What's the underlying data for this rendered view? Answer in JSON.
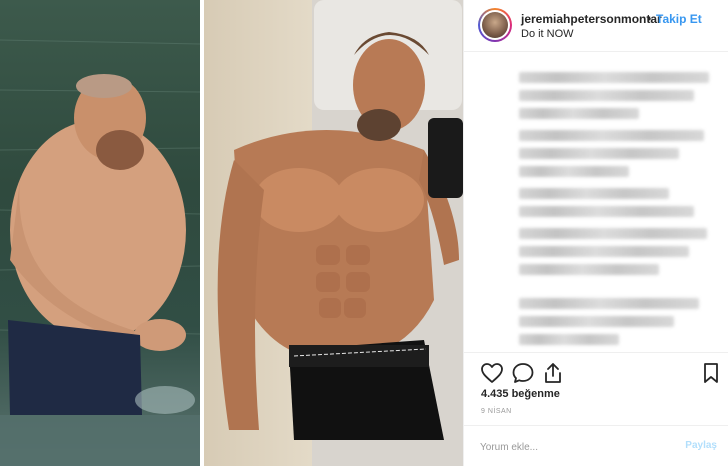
{
  "post": {
    "image": {
      "left_panel": "before-photo",
      "right_panel": "after-photo"
    }
  },
  "header": {
    "username": "jeremiahpetersonmontar",
    "dot": "•",
    "follow_label": "Takip Et",
    "subtitle": "Do it NOW"
  },
  "actions": {
    "like_icon": "heart-icon",
    "comment_icon": "comment-icon",
    "share_icon": "share-icon",
    "save_icon": "bookmark-icon"
  },
  "likes_text": "4.435 beğenme",
  "date_text": "9 NİSAN",
  "comment": {
    "placeholder": "Yorum ekle...",
    "submit_label": "Paylaş"
  },
  "colors": {
    "accent": "#3897f0",
    "muted": "#999999",
    "border": "#efefef"
  }
}
